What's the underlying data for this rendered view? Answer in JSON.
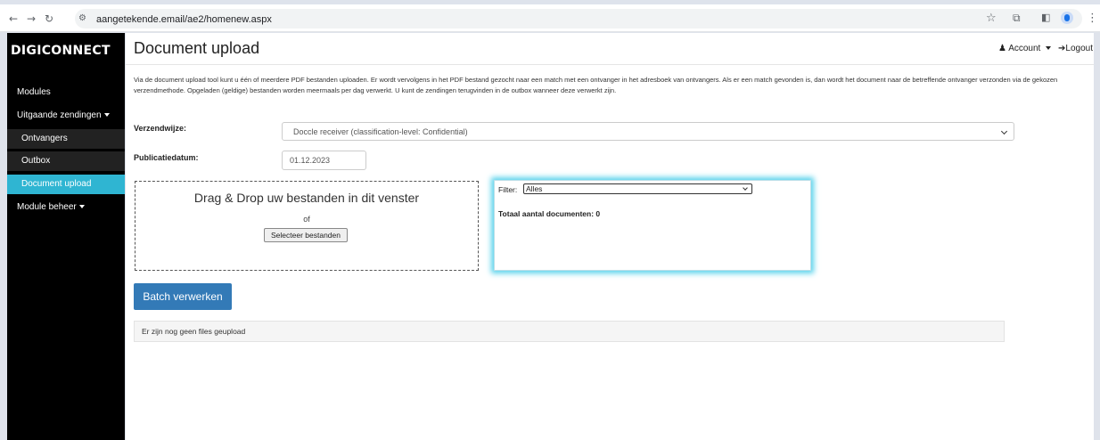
{
  "browser": {
    "back_icon": "arrow-left-icon",
    "forward_icon": "arrow-right-icon",
    "reload_icon": "reload-icon",
    "url": "aangetekende.email/ae2/homenew.aspx",
    "star_icon": "star-icon",
    "extensions_icon": "puzzle-icon",
    "sidepanel_icon": "sidepanel-icon",
    "menu_icon": "more-vert-icon"
  },
  "app": {
    "logo_prefix": "DIGI",
    "logo_suffix": "NNECT",
    "page_title": "Document upload",
    "account_label": "Account",
    "logout_label": "Logout"
  },
  "sidebar": {
    "items": [
      {
        "label": "Modules"
      },
      {
        "label": "Uitgaande zendingen"
      },
      {
        "label": "Ontvangers"
      },
      {
        "label": "Outbox"
      },
      {
        "label": "Document upload"
      },
      {
        "label": "Module beheer"
      }
    ],
    "active_color": "#2fb5d2"
  },
  "main": {
    "intro": "Via de document upload tool kunt u één of meerdere PDF bestanden uploaden. Er wordt vervolgens in het PDF bestand gezocht naar een match met een ontvanger in het adresboek van ontvangers. Als er een match gevonden is, dan wordt het document naar de betreffende ontvanger verzonden via de gekozen verzendmethode. Opgeladen (geldige) bestanden worden meermaals per dag verwerkt. U kunt de zendingen terugvinden in de outbox wanneer deze verwerkt zijn.",
    "verzendwijze_label": "Verzendwijze:",
    "verzendwijze_value": "Doccle receiver (classification-level: Confidential)",
    "publicatiedatum_label": "Publicatiedatum:",
    "publicatiedatum_value": "01.12.2023",
    "dropzone_title": "Drag & Drop uw bestanden in dit venster",
    "dropzone_of": "of",
    "select_files_label": "Selecteer bestanden",
    "filter_label": "Filter:",
    "filter_value": "Alles",
    "total_label": "Totaal aantal documenten: 0",
    "batch_button": "Batch verwerken",
    "no_files_text": "Er zijn nog geen files geupload",
    "primary_color": "#337ab7"
  }
}
